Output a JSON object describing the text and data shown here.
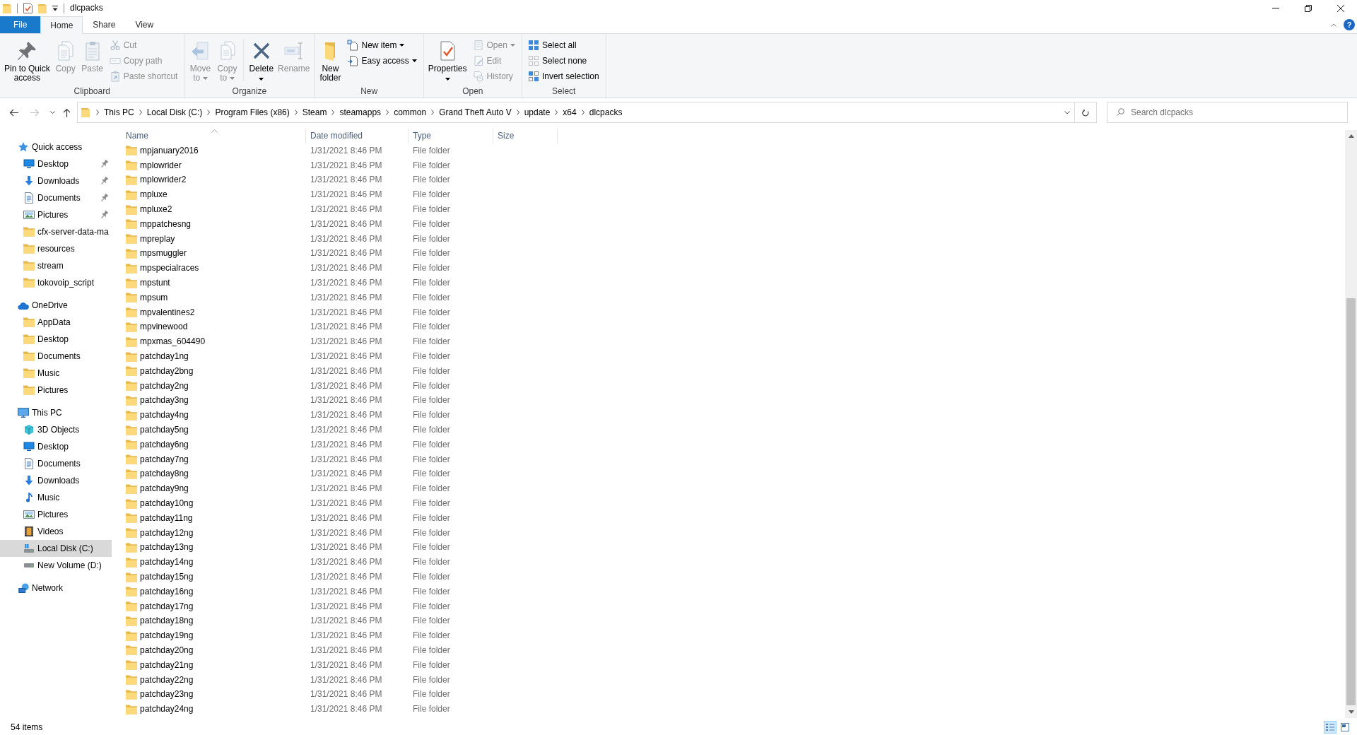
{
  "window": {
    "title": "dlcpacks"
  },
  "ribbon": {
    "tabs": [
      {
        "label": "File",
        "kind": "menu",
        "selected": false
      },
      {
        "label": "Home",
        "kind": "tab",
        "selected": true
      },
      {
        "label": "Share",
        "kind": "tab",
        "selected": false
      },
      {
        "label": "View",
        "kind": "tab",
        "selected": false
      }
    ],
    "help": "?",
    "groups": [
      {
        "label": "Clipboard",
        "sections": [
          {
            "kind": "large",
            "buttons": [
              {
                "lines": [
                  "Pin to Quick",
                  "access"
                ],
                "kind": "pin",
                "disabled": false,
                "dropdown": false
              },
              {
                "lines": [
                  "Copy"
                ],
                "kind": "copy",
                "disabled": true,
                "dropdown": false
              },
              {
                "lines": [
                  "Paste"
                ],
                "kind": "paste",
                "disabled": true,
                "dropdown": false
              }
            ]
          },
          {
            "kind": "small",
            "buttons": [
              {
                "label": "Cut",
                "kind": "cut",
                "disabled": true,
                "dropdown": false
              },
              {
                "label": "Copy path",
                "kind": "copypath",
                "disabled": true,
                "dropdown": false
              },
              {
                "label": "Paste shortcut",
                "kind": "pasteshortcut",
                "disabled": true,
                "dropdown": false
              }
            ]
          }
        ]
      },
      {
        "label": "Organize",
        "sections": [
          {
            "kind": "large",
            "buttons": [
              {
                "lines": [
                  "Move",
                  "to"
                ],
                "kind": "move",
                "disabled": true,
                "dropdown": true
              },
              {
                "lines": [
                  "Copy",
                  "to"
                ],
                "kind": "copyto",
                "disabled": true,
                "dropdown": true
              }
            ]
          },
          {
            "kind": "large",
            "buttons": [
              {
                "lines": [
                  "Delete"
                ],
                "kind": "delete",
                "disabled": false,
                "dropdown": true
              },
              {
                "lines": [
                  "Rename"
                ],
                "kind": "rename",
                "disabled": true,
                "dropdown": false
              }
            ]
          }
        ]
      },
      {
        "label": "New",
        "sections": [
          {
            "kind": "large",
            "buttons": [
              {
                "lines": [
                  "New",
                  "folder"
                ],
                "kind": "newfolder",
                "disabled": false,
                "dropdown": false
              }
            ]
          },
          {
            "kind": "small",
            "buttons": [
              {
                "label": "New item",
                "kind": "newitem",
                "disabled": false,
                "dropdown": true
              },
              {
                "label": "Easy access",
                "kind": "easyaccess",
                "disabled": false,
                "dropdown": true
              }
            ]
          }
        ]
      },
      {
        "label": "Open",
        "sections": [
          {
            "kind": "large",
            "buttons": [
              {
                "lines": [
                  "Properties"
                ],
                "kind": "properties",
                "disabled": false,
                "dropdown": true
              }
            ]
          },
          {
            "kind": "small",
            "buttons": [
              {
                "label": "Open",
                "kind": "open",
                "disabled": true,
                "dropdown": true
              },
              {
                "label": "Edit",
                "kind": "edit",
                "disabled": true,
                "dropdown": false
              },
              {
                "label": "History",
                "kind": "history",
                "disabled": true,
                "dropdown": false
              }
            ]
          }
        ]
      },
      {
        "label": "Select",
        "sections": [
          {
            "kind": "small",
            "buttons": [
              {
                "label": "Select all",
                "kind": "selectall",
                "disabled": false,
                "dropdown": false
              },
              {
                "label": "Select none",
                "kind": "selectnone",
                "disabled": false,
                "dropdown": false
              },
              {
                "label": "Invert selection",
                "kind": "invert",
                "disabled": false,
                "dropdown": false
              }
            ]
          }
        ]
      }
    ]
  },
  "navigation": {
    "buttons": [
      {
        "kind": "back",
        "disabled": false
      },
      {
        "kind": "forward",
        "disabled": true
      },
      {
        "kind": "recent",
        "disabled": false
      },
      {
        "kind": "up",
        "disabled": false
      }
    ],
    "breadcrumbs": [
      "This PC",
      "Local Disk (C:)",
      "Program Files (x86)",
      "Steam",
      "steamapps",
      "common",
      "Grand Theft Auto V",
      "update",
      "x64",
      "dlcpacks"
    ],
    "search": {
      "placeholder": "Search dlcpacks"
    }
  },
  "sidebar": {
    "sections": [
      {
        "label": "Quick access",
        "kind": "quickaccess",
        "selected": false,
        "children": [
          {
            "label": "Desktop",
            "kind": "desktop",
            "pinned": true,
            "selected": false
          },
          {
            "label": "Downloads",
            "kind": "downloads",
            "pinned": true,
            "selected": false
          },
          {
            "label": "Documents",
            "kind": "documents",
            "pinned": true,
            "selected": false
          },
          {
            "label": "Pictures",
            "kind": "pictures",
            "pinned": true,
            "selected": false
          },
          {
            "label": "cfx-server-data-ma",
            "kind": "folder",
            "pinned": false,
            "selected": false
          },
          {
            "label": "resources",
            "kind": "folder",
            "pinned": false,
            "selected": false
          },
          {
            "label": "stream",
            "kind": "folder",
            "pinned": false,
            "selected": false
          },
          {
            "label": "tokovoip_script",
            "kind": "folder",
            "pinned": false,
            "selected": false
          }
        ]
      },
      {
        "label": "OneDrive",
        "kind": "cloud",
        "selected": false,
        "children": [
          {
            "label": "AppData",
            "kind": "folder",
            "pinned": false,
            "selected": false
          },
          {
            "label": "Desktop",
            "kind": "folder",
            "pinned": false,
            "selected": false
          },
          {
            "label": "Documents",
            "kind": "folder",
            "pinned": false,
            "selected": false
          },
          {
            "label": "Music",
            "kind": "folder",
            "pinned": false,
            "selected": false
          },
          {
            "label": "Pictures",
            "kind": "folder",
            "pinned": false,
            "selected": false
          }
        ]
      },
      {
        "label": "This PC",
        "kind": "computer",
        "selected": false,
        "children": [
          {
            "label": "3D Objects",
            "kind": "objects3d",
            "pinned": false,
            "selected": false
          },
          {
            "label": "Desktop",
            "kind": "desktop",
            "pinned": false,
            "selected": false
          },
          {
            "label": "Documents",
            "kind": "documents",
            "pinned": false,
            "selected": false
          },
          {
            "label": "Downloads",
            "kind": "downloads",
            "pinned": false,
            "selected": false
          },
          {
            "label": "Music",
            "kind": "music",
            "pinned": false,
            "selected": false
          },
          {
            "label": "Pictures",
            "kind": "pictures",
            "pinned": false,
            "selected": false
          },
          {
            "label": "Videos",
            "kind": "videos",
            "pinned": false,
            "selected": false
          },
          {
            "label": "Local Disk (C:)",
            "kind": "systemdrive",
            "pinned": false,
            "selected": true
          },
          {
            "label": "New Volume (D:)",
            "kind": "drive",
            "pinned": false,
            "selected": false
          }
        ]
      },
      {
        "label": "Network",
        "kind": "network",
        "selected": false
      }
    ]
  },
  "file_list": {
    "columns": [
      {
        "label": "Name",
        "sorted": true
      },
      {
        "label": "Date modified",
        "sorted": false
      },
      {
        "label": "Type",
        "sorted": false
      },
      {
        "label": "Size",
        "sorted": false
      }
    ],
    "rows": [
      {
        "name": "mpjanuary2016",
        "date_modified": "1/31/2021 8:46 PM",
        "type": "File folder",
        "selected": false
      },
      {
        "name": "mplowrider",
        "date_modified": "1/31/2021 8:46 PM",
        "type": "File folder",
        "selected": false
      },
      {
        "name": "mplowrider2",
        "date_modified": "1/31/2021 8:46 PM",
        "type": "File folder",
        "selected": false
      },
      {
        "name": "mpluxe",
        "date_modified": "1/31/2021 8:46 PM",
        "type": "File folder",
        "selected": false
      },
      {
        "name": "mpluxe2",
        "date_modified": "1/31/2021 8:46 PM",
        "type": "File folder",
        "selected": false
      },
      {
        "name": "mppatchesng",
        "date_modified": "1/31/2021 8:46 PM",
        "type": "File folder",
        "selected": false
      },
      {
        "name": "mpreplay",
        "date_modified": "1/31/2021 8:46 PM",
        "type": "File folder",
        "selected": false
      },
      {
        "name": "mpsmuggler",
        "date_modified": "1/31/2021 8:46 PM",
        "type": "File folder",
        "selected": false
      },
      {
        "name": "mpspecialraces",
        "date_modified": "1/31/2021 8:46 PM",
        "type": "File folder",
        "selected": false
      },
      {
        "name": "mpstunt",
        "date_modified": "1/31/2021 8:46 PM",
        "type": "File folder",
        "selected": false
      },
      {
        "name": "mpsum",
        "date_modified": "1/31/2021 8:46 PM",
        "type": "File folder",
        "selected": false
      },
      {
        "name": "mpvalentines2",
        "date_modified": "1/31/2021 8:46 PM",
        "type": "File folder",
        "selected": false
      },
      {
        "name": "mpvinewood",
        "date_modified": "1/31/2021 8:46 PM",
        "type": "File folder",
        "selected": false
      },
      {
        "name": "mpxmas_604490",
        "date_modified": "1/31/2021 8:46 PM",
        "type": "File folder",
        "selected": false
      },
      {
        "name": "patchday1ng",
        "date_modified": "1/31/2021 8:46 PM",
        "type": "File folder",
        "selected": false
      },
      {
        "name": "patchday2bng",
        "date_modified": "1/31/2021 8:46 PM",
        "type": "File folder",
        "selected": false
      },
      {
        "name": "patchday2ng",
        "date_modified": "1/31/2021 8:46 PM",
        "type": "File folder",
        "selected": false
      },
      {
        "name": "patchday3ng",
        "date_modified": "1/31/2021 8:46 PM",
        "type": "File folder",
        "selected": false
      },
      {
        "name": "patchday4ng",
        "date_modified": "1/31/2021 8:46 PM",
        "type": "File folder",
        "selected": false
      },
      {
        "name": "patchday5ng",
        "date_modified": "1/31/2021 8:46 PM",
        "type": "File folder",
        "selected": false
      },
      {
        "name": "patchday6ng",
        "date_modified": "1/31/2021 8:46 PM",
        "type": "File folder",
        "selected": false
      },
      {
        "name": "patchday7ng",
        "date_modified": "1/31/2021 8:46 PM",
        "type": "File folder",
        "selected": false
      },
      {
        "name": "patchday8ng",
        "date_modified": "1/31/2021 8:46 PM",
        "type": "File folder",
        "selected": false
      },
      {
        "name": "patchday9ng",
        "date_modified": "1/31/2021 8:46 PM",
        "type": "File folder",
        "selected": false
      },
      {
        "name": "patchday10ng",
        "date_modified": "1/31/2021 8:46 PM",
        "type": "File folder",
        "selected": false
      },
      {
        "name": "patchday11ng",
        "date_modified": "1/31/2021 8:46 PM",
        "type": "File folder",
        "selected": false
      },
      {
        "name": "patchday12ng",
        "date_modified": "1/31/2021 8:46 PM",
        "type": "File folder",
        "selected": false
      },
      {
        "name": "patchday13ng",
        "date_modified": "1/31/2021 8:46 PM",
        "type": "File folder",
        "selected": false
      },
      {
        "name": "patchday14ng",
        "date_modified": "1/31/2021 8:46 PM",
        "type": "File folder",
        "selected": false
      },
      {
        "name": "patchday15ng",
        "date_modified": "1/31/2021 8:46 PM",
        "type": "File folder",
        "selected": false
      },
      {
        "name": "patchday16ng",
        "date_modified": "1/31/2021 8:46 PM",
        "type": "File folder",
        "selected": false
      },
      {
        "name": "patchday17ng",
        "date_modified": "1/31/2021 8:46 PM",
        "type": "File folder",
        "selected": false
      },
      {
        "name": "patchday18ng",
        "date_modified": "1/31/2021 8:46 PM",
        "type": "File folder",
        "selected": false
      },
      {
        "name": "patchday19ng",
        "date_modified": "1/31/2021 8:46 PM",
        "type": "File folder",
        "selected": false
      },
      {
        "name": "patchday20ng",
        "date_modified": "1/31/2021 8:46 PM",
        "type": "File folder",
        "selected": false
      },
      {
        "name": "patchday21ng",
        "date_modified": "1/31/2021 8:46 PM",
        "type": "File folder",
        "selected": false
      },
      {
        "name": "patchday22ng",
        "date_modified": "1/31/2021 8:46 PM",
        "type": "File folder",
        "selected": false
      },
      {
        "name": "patchday23ng",
        "date_modified": "1/31/2021 8:46 PM",
        "type": "File folder",
        "selected": false
      },
      {
        "name": "patchday24ng",
        "date_modified": "1/31/2021 8:46 PM",
        "type": "File folder",
        "selected": false
      }
    ]
  },
  "status_bar": {
    "item_count": "54 items",
    "views": [
      {
        "kind": "details",
        "selected": true
      },
      {
        "kind": "largeicons",
        "selected": false
      }
    ]
  }
}
